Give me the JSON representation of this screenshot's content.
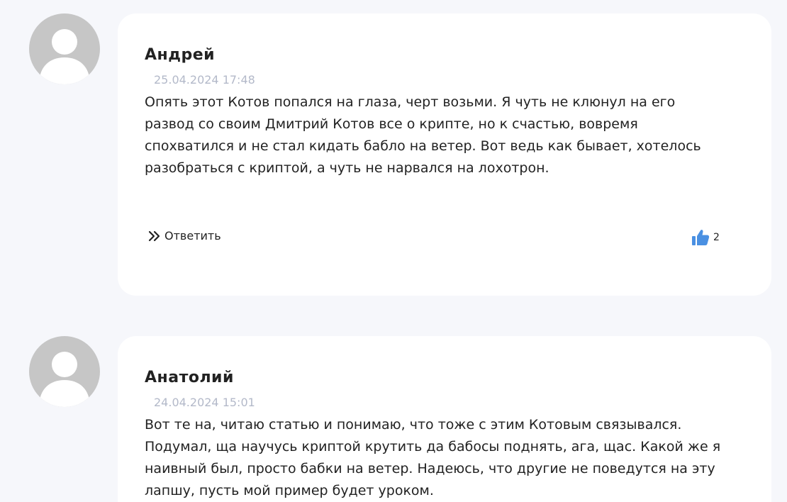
{
  "comments": [
    {
      "author": "Андрей",
      "date": "25.04.2024 17:48",
      "text": "Опять этот Котов попался на глаза, черт возьми. Я чуть не клюнул на его развод со своим Дмитрий Котов все о крипте, но к счастью, вовремя спохватился и не стал кидать бабло на ветер. Вот ведь как бывает, хотелось разобраться с криптой, а чуть не нарвался на лохотрон.",
      "reply_label": "Ответить",
      "likes": "2"
    },
    {
      "author": "Анатолий",
      "date": "24.04.2024 15:01",
      "text": "Вот те на, читаю статью и понимаю, что тоже с этим Котовым связывался. Подумал, ща научусь криптой крутить да бабосы поднять, ага, щас. Какой же я наивный был, просто бабки на ветер. Надеюсь, что другие не поведутся на эту лапшу, пусть мой пример будет уроком."
    }
  ],
  "colors": {
    "page_background": "#f6f7fb",
    "card_background": "#ffffff",
    "avatar_background": "#c6c6c6",
    "date_text": "#b3b9c9",
    "like_icon": "#4a90e2"
  },
  "icons": {
    "reply": "double-chevron-right-icon",
    "like": "thumbs-up-icon",
    "avatar": "user-silhouette-icon"
  }
}
